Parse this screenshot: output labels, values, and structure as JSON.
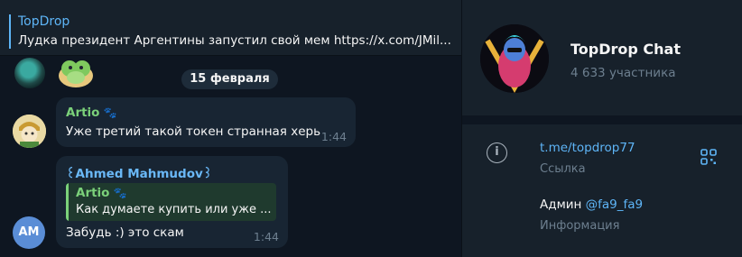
{
  "pinned": {
    "title": "TopDrop",
    "text": "Лудка президент Аргентины запустил свой мем    https://x.com/JMil..."
  },
  "date_separator": "15 февраля",
  "messages": [
    {
      "sender": "Artio",
      "text": "Уже третий такой токен странная херь",
      "time": "1:44"
    },
    {
      "sender": "꒰Ahmed Mahmudov꒱",
      "reply": {
        "sender": "Artio",
        "text": "Как думаете купить или уже ..."
      },
      "text": "Забудь :) это скам",
      "time": "1:44",
      "avatar_initials": "AM"
    }
  ],
  "info": {
    "name": "TopDrop Chat",
    "members": "4 633 участника",
    "link": "t.me/topdrop77",
    "link_caption": "Ссылка",
    "admin_prefix": "Админ ",
    "admin_handle": "@fa9_fa9",
    "admin_caption": "Информация"
  },
  "icons": {
    "paw": "paw-icon",
    "info": "info-icon",
    "qr": "qr-code-icon"
  },
  "colors": {
    "accent": "#5eb5f7",
    "artio": "#7bd17a",
    "ahmed": "#6ab8f7",
    "bubble": "#182533",
    "background": "#0e1621",
    "panel": "#17212b"
  }
}
